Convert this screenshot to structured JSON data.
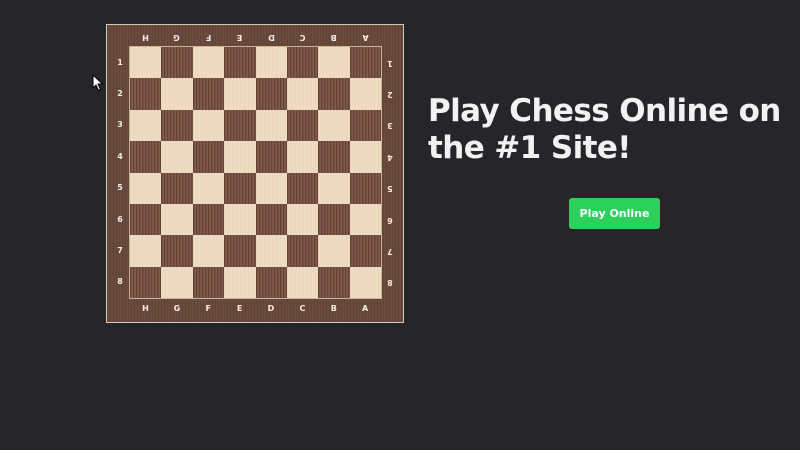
{
  "board": {
    "files_top": [
      "H",
      "G",
      "F",
      "E",
      "D",
      "C",
      "B",
      "A"
    ],
    "files_bottom": [
      "H",
      "G",
      "F",
      "E",
      "D",
      "C",
      "B",
      "A"
    ],
    "ranks_left": [
      "1",
      "2",
      "3",
      "4",
      "5",
      "6",
      "7",
      "8"
    ],
    "ranks_right": [
      "1",
      "2",
      "3",
      "4",
      "5",
      "6",
      "7",
      "8"
    ],
    "orientation": "black-at-bottom",
    "light_color": "#eedcc2",
    "dark_color": "#7a5244",
    "frame_color": "#6a4a3c"
  },
  "hero": {
    "headline": "Play Chess Online on the #1 Site!",
    "button_label": "Play Online",
    "button_color": "#2bd15a"
  },
  "cursor_icon": "arrow-pointer-icon"
}
